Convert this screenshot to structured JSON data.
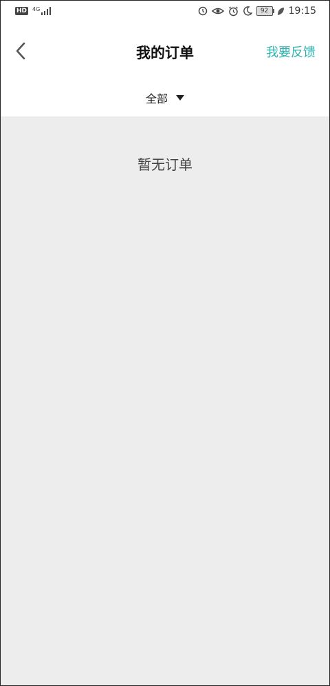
{
  "status_bar": {
    "hd_badge": "HD",
    "network": "4G",
    "battery_level": "92",
    "time": "19:15",
    "icons": [
      "hd-icon",
      "signal-icon",
      "data-saver-icon",
      "eye-icon",
      "alarm-icon",
      "moon-icon",
      "battery-icon",
      "leaf-icon"
    ]
  },
  "header": {
    "title": "我的订单",
    "feedback_label": "我要反馈",
    "back_icon": "chevron-left-icon",
    "accent_color": "#2fb3b0"
  },
  "filter": {
    "selected": "全部",
    "icon": "caret-down-icon"
  },
  "content": {
    "empty_message": "暂无订单",
    "background": "#ededed"
  }
}
